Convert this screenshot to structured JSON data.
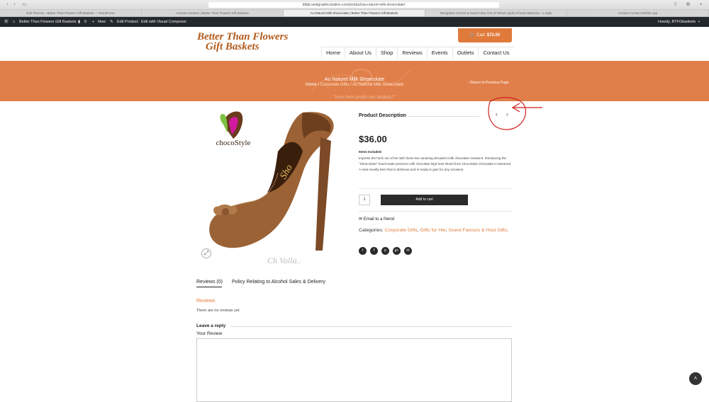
{
  "browser": {
    "url": "btfgb.webgraphicstudios.com/product/au-naturel-milk-shoecolate/",
    "tabs": [
      "Edit Themes ‹ Better Than Flowers Gift Baskets — WordPress",
      "Animal Crackers | Better Than Flowers Gift Baskets",
      "Au Naturel Milk Shoecolate | Better Than Flowers Gift Baskets",
      "Navigation Circles & Search Box Out of Whack (split of forum Bheema - 1 reply",
      "Contact Contact Mobile App"
    ]
  },
  "wpbar": {
    "site": "Better Than Flowers Gift Baskets",
    "comments": "0",
    "new": "New",
    "edit_product": "Edit Product",
    "visual_composer": "Edit with Visual Composer",
    "howdy": "Howdy, BTFGbaskets"
  },
  "header": {
    "logo_line1": "Better Than Flowers",
    "logo_line2": "Gift Baskets",
    "cart_label": "Cart:",
    "cart_total": "$72.00",
    "menu": [
      "Home",
      "About Us",
      "Shop",
      "Reviews",
      "Events",
      "Outlets",
      "Contact Us"
    ]
  },
  "banner": {
    "title": "Au Naturel Milk Shoecolate",
    "breadcrumb_home": "Home",
    "breadcrumb_sep": "/",
    "breadcrumb_category": "Corporate Gifts",
    "breadcrumb_current": "Au Naturel Milk Shoecolate",
    "return_link": "Return to Previous Page",
    "tagline": "\"even bees prefer our baskets!\""
  },
  "product": {
    "image_brand": "chocoStyle",
    "description_heading": "Product Description",
    "price": "$36.00",
    "items_label": "Items Included:",
    "items_text": "Impress the heck out of her with these two amazing decadent milk chocolate creations. Introducing the \"Shoecolate\" hand-made premium milk chocolate high heel shoes from chocoStyle Chocolate in Montreal. A neat novelty item that is delicious and is ready to give for any occasion.",
    "quantity": "1",
    "add_to_cart": "Add to cart",
    "email_friend": "Email to a friend",
    "categories_label": "Categories:",
    "categories": [
      "Corporate Gifts",
      "Gifts for Her",
      "Guest Favours & Host Gifts"
    ]
  },
  "tabs": {
    "reviews": "Reviews (0)",
    "policy": "Policy Relating to Alcohol Sales & Delivery"
  },
  "reviews": {
    "heading": "Reviews",
    "empty": "There are no reviews yet.",
    "leave_reply": "Leave a reply",
    "your_review": "Your Review"
  },
  "colors": {
    "accent": "#e07a3b",
    "banner": "#e07f4a",
    "wpbar": "#23282d"
  }
}
